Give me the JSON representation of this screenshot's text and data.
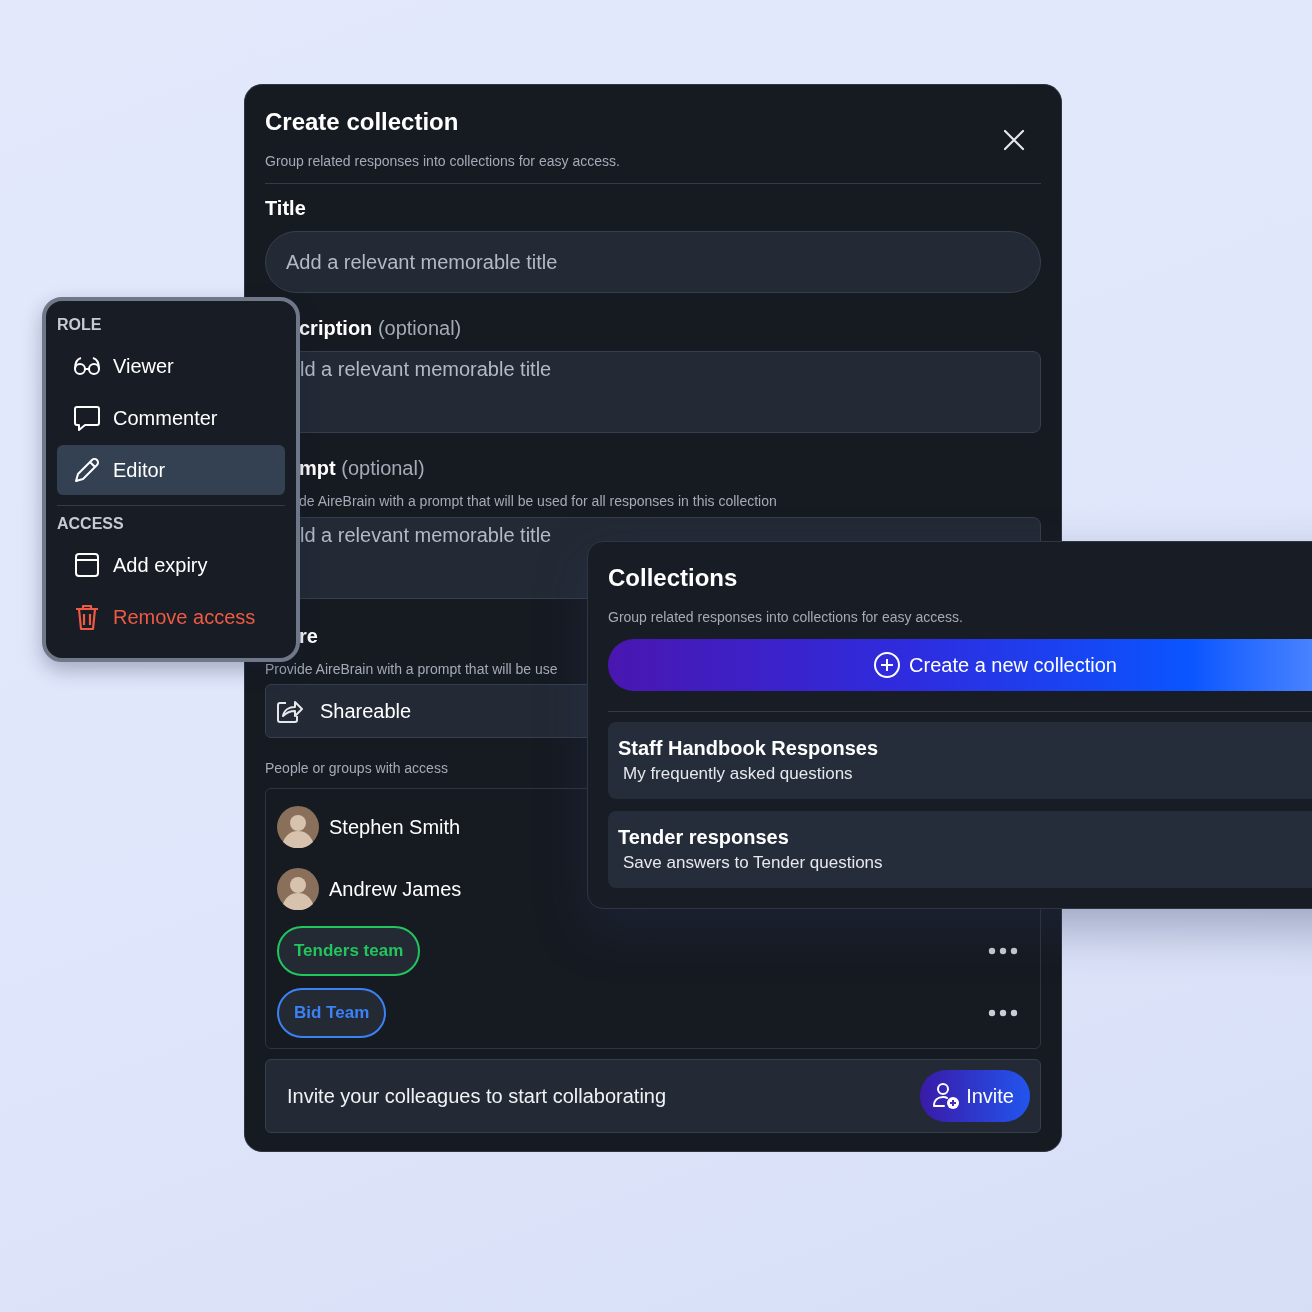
{
  "create_dialog": {
    "title": "Create collection",
    "subtitle": "Group related responses into collections for easy access.",
    "title_field": {
      "label": "Title",
      "placeholder": "Add a relevant memorable title"
    },
    "description": {
      "label": "cription",
      "note": "(optional)",
      "placeholder": "ld a relevant memorable title"
    },
    "prompt": {
      "label": "mpt",
      "note": "(optional)",
      "hint": "de AireBrain with a prompt that will be used for all responses in this collection",
      "placeholder": "ld a relevant memorable title"
    },
    "share": {
      "label": "re",
      "hint": "Provide AireBrain with a prompt that will be use",
      "option": "Shareable"
    },
    "access_label": "People or groups with access",
    "members": [
      {
        "kind": "person",
        "name": "Stephen Smith"
      },
      {
        "kind": "person",
        "name": "Andrew James"
      },
      {
        "kind": "group",
        "name": "Tenders team",
        "color": "#22c55e"
      },
      {
        "kind": "group",
        "name": "Bid Team",
        "color": "#3b82f6"
      }
    ],
    "invite": {
      "text": "Invite your colleagues to start collaborating",
      "button": "Invite"
    }
  },
  "role_menu": {
    "sections": [
      {
        "heading": "ROLE",
        "items": [
          {
            "label": "Viewer",
            "kind": "normal",
            "selected": false
          },
          {
            "label": "Commenter",
            "kind": "normal",
            "selected": false
          },
          {
            "label": "Editor",
            "kind": "normal",
            "selected": true
          }
        ]
      },
      {
        "heading": "ACCESS",
        "items": [
          {
            "label": "Add expiry",
            "kind": "normal",
            "selected": false
          },
          {
            "label": "Remove access",
            "kind": "danger",
            "selected": false
          }
        ]
      }
    ]
  },
  "collections_panel": {
    "title": "Collections",
    "subtitle": "Group related responses into collections for easy access.",
    "create_button": "Create a new collection",
    "items": [
      {
        "title": "Staff Handbook Responses",
        "subtitle": "My frequently asked questions"
      },
      {
        "title": "Tender responses",
        "subtitle": "Save answers to Tender questions"
      }
    ]
  }
}
